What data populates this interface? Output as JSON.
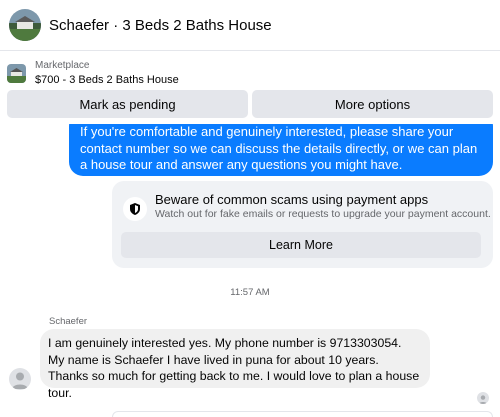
{
  "header": {
    "title": "Schaefer · 3 Beds 2 Baths House",
    "avatar_icon": "house-photo-icon"
  },
  "listing": {
    "label": "Marketplace",
    "title": "$700 - 3 Beds 2 Baths House"
  },
  "actions": {
    "mark_pending": "Mark as pending",
    "more_options": "More options"
  },
  "messages": {
    "outgoing_text": "If you're comfortable and genuinely interested, please share your contact number so we can discuss the details directly, or we can plan a house tour and answer any questions you might have.",
    "scam_warning": {
      "title": "Beware of common scams using payment apps",
      "subtitle": "Watch out for fake emails or requests to upgrade your payment account.",
      "button": "Learn More",
      "icon": "shield-icon"
    },
    "timestamp": "11:57 AM",
    "sender_name": "Schaefer",
    "incoming_text": "I am genuinely interested yes. My phone number is 9713303054. My name is Schaefer I have lived in puna for about 10 years. Thanks so much for getting back to me. I would love to plan a house tour."
  },
  "colors": {
    "accent": "#0a7cff",
    "button_bg": "#e4e6eb",
    "incoming_bg": "#f0f0f0",
    "card_bg": "#f0f2f5",
    "secondary_text": "#65676b"
  }
}
